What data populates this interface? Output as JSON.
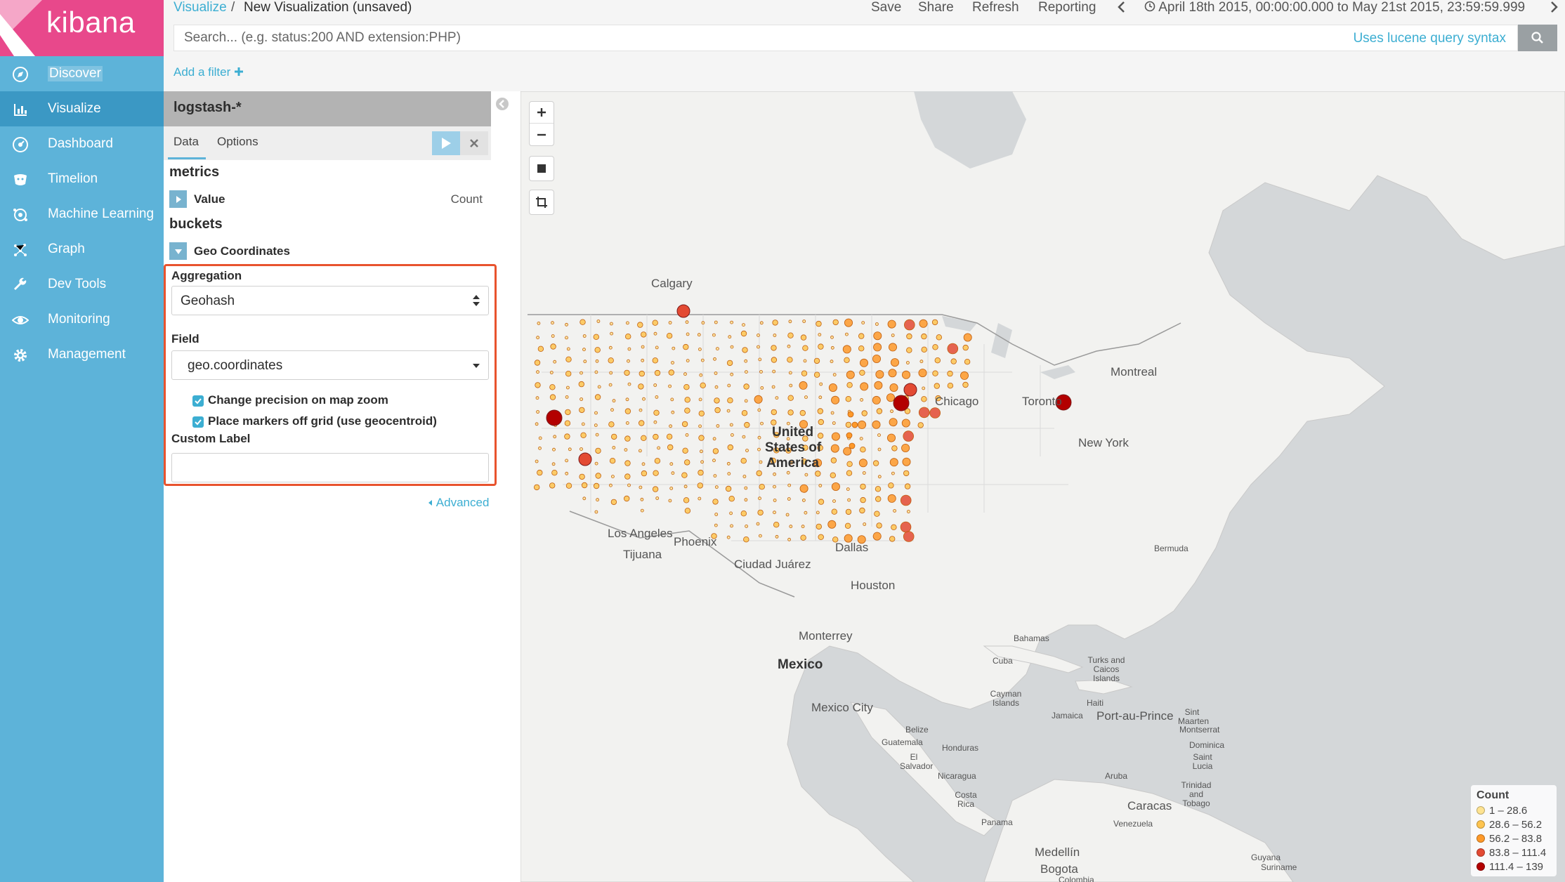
{
  "app": {
    "brand": "kibana"
  },
  "sidebar": {
    "items": [
      {
        "label": "Discover",
        "icon": "compass-icon"
      },
      {
        "label": "Visualize",
        "icon": "bar-chart-icon"
      },
      {
        "label": "Dashboard",
        "icon": "dashboard-icon"
      },
      {
        "label": "Timelion",
        "icon": "timelion-icon"
      },
      {
        "label": "Machine Learning",
        "icon": "machine-learning-icon"
      },
      {
        "label": "Graph",
        "icon": "graph-icon"
      },
      {
        "label": "Dev Tools",
        "icon": "wrench-icon"
      },
      {
        "label": "Monitoring",
        "icon": "eye-icon"
      },
      {
        "label": "Management",
        "icon": "gear-icon"
      }
    ]
  },
  "header": {
    "breadcrumb_link": "Visualize",
    "breadcrumb_sep": "/",
    "breadcrumb_current": "New Visualization (unsaved)",
    "menu": [
      "Save",
      "Share",
      "Refresh",
      "Reporting"
    ],
    "time_range": "April 18th 2015, 00:00:00.000 to May 21st 2015, 23:59:59.999"
  },
  "search": {
    "placeholder": "Search... (e.g. status:200 AND extension:PHP)",
    "hint": "Uses lucene query syntax"
  },
  "filter": {
    "add_label": "Add a filter"
  },
  "editor": {
    "index_pattern": "logstash-*",
    "tabs": [
      "Data",
      "Options"
    ],
    "metrics_title": "metrics",
    "metric": {
      "label": "Value",
      "type": "Count"
    },
    "buckets_title": "buckets",
    "bucket": {
      "label": "Geo Coordinates"
    },
    "aggregation_label": "Aggregation",
    "aggregation_value": "Geohash",
    "field_label": "Field",
    "field_value": "geo.coordinates",
    "checkboxes": [
      {
        "label": "Change precision on map zoom",
        "checked": true
      },
      {
        "label": "Place markers off grid (use geocentroid)",
        "checked": true
      }
    ],
    "custom_label_title": "Custom Label",
    "custom_label_value": "",
    "advanced_label": "Advanced"
  },
  "map": {
    "labels": [
      {
        "text": "Calgary",
        "cls": ""
      },
      {
        "text": "United",
        "cls": "big"
      },
      {
        "text": "States of",
        "cls": "big"
      },
      {
        "text": "America",
        "cls": "big"
      },
      {
        "text": "Montreal",
        "cls": ""
      },
      {
        "text": "Toronto",
        "cls": ""
      },
      {
        "text": "Chicago",
        "cls": ""
      },
      {
        "text": "New York",
        "cls": ""
      },
      {
        "text": "Los Angeles",
        "cls": ""
      },
      {
        "text": "Phoenix",
        "cls": ""
      },
      {
        "text": "Tijuana",
        "cls": ""
      },
      {
        "text": "Ciudad Juárez",
        "cls": ""
      },
      {
        "text": "Dallas",
        "cls": ""
      },
      {
        "text": "Houston",
        "cls": ""
      },
      {
        "text": "Monterrey",
        "cls": ""
      },
      {
        "text": "Mexico",
        "cls": "big"
      },
      {
        "text": "Mexico City",
        "cls": ""
      },
      {
        "text": "Bermuda",
        "cls": "sm"
      },
      {
        "text": "Bahamas",
        "cls": "sm"
      },
      {
        "text": "Cuba",
        "cls": "sm"
      },
      {
        "text": "Turks and Caicos Islands",
        "cls": "sm"
      },
      {
        "text": "Cayman Islands",
        "cls": "sm"
      },
      {
        "text": "Jamaica",
        "cls": "sm"
      },
      {
        "text": "Haiti",
        "cls": "sm"
      },
      {
        "text": "Port-au-Prince",
        "cls": ""
      },
      {
        "text": "Sint Maarten",
        "cls": "sm"
      },
      {
        "text": "Montserrat",
        "cls": "sm"
      },
      {
        "text": "Dominica",
        "cls": "sm"
      },
      {
        "text": "Saint Lucia",
        "cls": "sm"
      },
      {
        "text": "Belize",
        "cls": "sm"
      },
      {
        "text": "Guatemala",
        "cls": "sm"
      },
      {
        "text": "Honduras",
        "cls": "sm"
      },
      {
        "text": "El Salvador",
        "cls": "sm"
      },
      {
        "text": "Nicaragua",
        "cls": "sm"
      },
      {
        "text": "Costa Rica",
        "cls": "sm"
      },
      {
        "text": "Panama",
        "cls": "sm"
      },
      {
        "text": "Aruba",
        "cls": "sm"
      },
      {
        "text": "Trinidad and Tobago",
        "cls": "sm"
      },
      {
        "text": "Caracas",
        "cls": ""
      },
      {
        "text": "Venezuela",
        "cls": "sm"
      },
      {
        "text": "Medellín",
        "cls": ""
      },
      {
        "text": "Bogota",
        "cls": ""
      },
      {
        "text": "Colombia",
        "cls": "sm"
      },
      {
        "text": "Guyana",
        "cls": "sm"
      },
      {
        "text": "Suriname",
        "cls": "sm"
      }
    ],
    "legend": {
      "title": "Count",
      "ranges": [
        {
          "label": "1 – 28.6",
          "color": "#fee391"
        },
        {
          "label": "28.6 – 56.2",
          "color": "#fec44f"
        },
        {
          "label": "56.2 – 83.8",
          "color": "#fe9929"
        },
        {
          "label": "83.8 – 111.4",
          "color": "#e34a33"
        },
        {
          "label": "111.4 – 139",
          "color": "#b30000"
        }
      ]
    }
  },
  "colors": {
    "accent": "#3caed2",
    "brand": "#e8488b",
    "sidebar": "#5db3d9",
    "highlight_border": "#e8532e"
  }
}
